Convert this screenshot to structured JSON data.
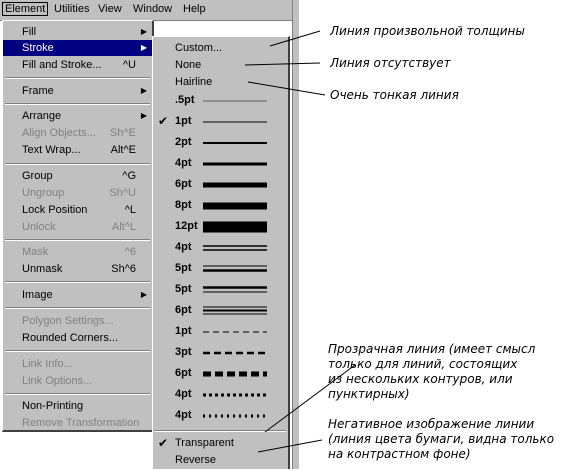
{
  "menubar": {
    "items": [
      {
        "label": "Element",
        "active": true
      },
      {
        "label": "Utilities"
      },
      {
        "label": "View"
      },
      {
        "label": "Window"
      },
      {
        "label": "Help"
      }
    ]
  },
  "element_menu": [
    {
      "label": "Fill",
      "submenu": true
    },
    {
      "label": "Stroke",
      "submenu": true,
      "highlighted": true
    },
    {
      "label": "Fill and Stroke...",
      "shortcut": "^U"
    },
    {
      "label": "Frame",
      "submenu": true
    },
    {
      "label": "Arrange",
      "submenu": true
    },
    {
      "label": "Align Objects...",
      "shortcut": "Sh^E",
      "disabled": true
    },
    {
      "label": "Text Wrap...",
      "shortcut": "Alt^E"
    },
    {
      "label": "Group",
      "shortcut": "^G"
    },
    {
      "label": "Ungroup",
      "shortcut": "Sh^U",
      "disabled": true
    },
    {
      "label": "Lock Position",
      "shortcut": "^L"
    },
    {
      "label": "Unlock",
      "shortcut": "Alt^L",
      "disabled": true
    },
    {
      "label": "Mask",
      "shortcut": "^6",
      "disabled": true
    },
    {
      "label": "Unmask",
      "shortcut": "Sh^6"
    },
    {
      "label": "Image",
      "submenu": true
    },
    {
      "label": "Polygon Settings...",
      "disabled": true
    },
    {
      "label": "Rounded Corners..."
    },
    {
      "label": "Link Info...",
      "disabled": true
    },
    {
      "label": "Link Options...",
      "disabled": true
    },
    {
      "label": "Non-Printing"
    },
    {
      "label": "Remove Transformation",
      "disabled": true
    }
  ],
  "stroke_menu": [
    {
      "label": "Custom...",
      "style": "plain"
    },
    {
      "label": "None",
      "style": "plain"
    },
    {
      "label": "Hairline",
      "style": "plain"
    },
    {
      "label": ".5pt",
      "line": "solid",
      "weight": 0.5
    },
    {
      "label": "1pt",
      "line": "solid",
      "weight": 1,
      "checked": true
    },
    {
      "label": "2pt",
      "line": "solid",
      "weight": 2
    },
    {
      "label": "4pt",
      "line": "solid",
      "weight": 4
    },
    {
      "label": "6pt",
      "line": "solid",
      "weight": 6
    },
    {
      "label": "8pt",
      "line": "solid",
      "weight": 8
    },
    {
      "label": "12pt",
      "line": "solid",
      "weight": 12
    },
    {
      "label": "4pt",
      "line": "double",
      "weight": 4
    },
    {
      "label": "5pt",
      "line": "double-thin-thick",
      "weight": 5
    },
    {
      "label": "5pt",
      "line": "double-thick-thin",
      "weight": 5
    },
    {
      "label": "6pt",
      "line": "triple",
      "weight": 6
    },
    {
      "label": "1pt",
      "line": "dashed",
      "weight": 1
    },
    {
      "label": "3pt",
      "line": "dashed",
      "weight": 3
    },
    {
      "label": "6pt",
      "line": "dashed",
      "weight": 6
    },
    {
      "label": "4pt",
      "line": "dotted",
      "weight": 4
    },
    {
      "label": "4pt",
      "line": "dotted-fine",
      "weight": 4
    },
    {
      "label": "Transparent",
      "style": "plain",
      "checked": true
    },
    {
      "label": "Reverse",
      "style": "plain"
    }
  ],
  "annotations": {
    "custom": "Линия произвольной толщины",
    "none": "Линия отсутствует",
    "hairline": "Очень тонкая линия",
    "transparent": [
      "Прозрачная линия (имеет смысл",
      "только для линий, состоящих",
      "из нескольких контуров, или",
      "пунктирных)"
    ],
    "reverse": [
      "Негативное изображение линии",
      "(линия цвета бумаги, видна только",
      "на контрастном фоне)"
    ]
  }
}
